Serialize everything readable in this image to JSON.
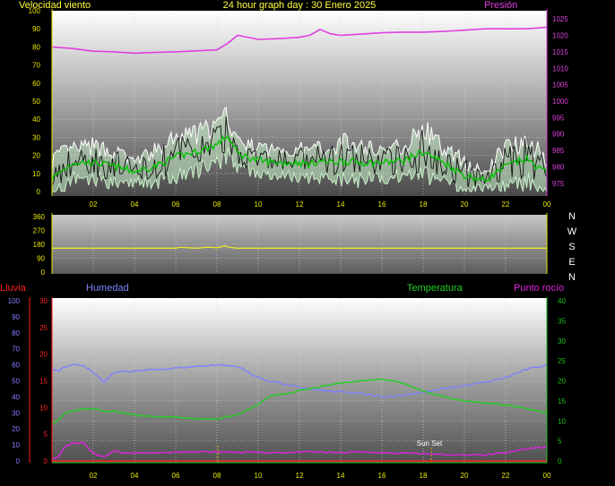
{
  "header": {
    "title": "24 hour graph day : 30 Enero 2025",
    "left_label": "Velocidad viento",
    "right_label": "Presión"
  },
  "colors": {
    "background": "#000000",
    "wind_speed": "#ffffff",
    "wind_avg": "#00c000",
    "wind_gust_fill": "#c8f0c8",
    "pressure": "#e040e0",
    "direction": "#e8e830",
    "humidity": "#8080ff",
    "temperature": "#20d020",
    "dewpoint": "#e020e0",
    "rain": "#ff2020",
    "axis_yellow": "#e8e800",
    "axis_red": "#ff2020",
    "axis_green": "#20c020",
    "marker": "#e0a000"
  },
  "time_ticks": [
    "02",
    "04",
    "06",
    "08",
    "10",
    "12",
    "14",
    "16",
    "18",
    "20",
    "22",
    "00"
  ],
  "chart_data": [
    {
      "type": "line",
      "name": "wind-pressure",
      "title": "24 hour graph day : 30 Enero 2025",
      "left_axis": {
        "label": "Velocidad viento",
        "ticks": [
          "0",
          "10",
          "20",
          "30",
          "40",
          "50",
          "60",
          "70",
          "80",
          "90",
          "100"
        ],
        "range": [
          0,
          100
        ]
      },
      "right_axis": {
        "label": "Presión",
        "ticks": [
          "975",
          "980",
          "985",
          "990",
          "995",
          "1000",
          "1005",
          "1010",
          "1015",
          "1020",
          "1025"
        ],
        "range": [
          972.5,
          1027.5
        ]
      },
      "x_hours": [
        0,
        1,
        2,
        3,
        4,
        5,
        6,
        7,
        8,
        8.5,
        9,
        10,
        11,
        12,
        12.5,
        13,
        13.5,
        14,
        15,
        16,
        17,
        18,
        19,
        20,
        21,
        22,
        23,
        24
      ],
      "series": [
        {
          "key": "pressure",
          "axis": "right",
          "values": [
            1016.5,
            1016,
            1015.2,
            1015,
            1014.6,
            1014.8,
            1015,
            1015.3,
            1015.6,
            1017.5,
            1020,
            1018.8,
            1019,
            1019.4,
            1020,
            1021.8,
            1020.5,
            1020,
            1020.4,
            1020.8,
            1021,
            1021,
            1021.2,
            1021.6,
            1022,
            1022,
            1022,
            1022.5
          ]
        },
        {
          "key": "wind_avg",
          "axis": "left",
          "values": [
            7,
            16,
            16,
            14,
            11,
            14,
            19,
            22,
            26,
            31,
            21,
            17,
            16,
            16,
            15,
            17,
            16,
            17,
            16,
            16,
            17,
            22,
            16,
            9,
            6,
            14,
            18,
            10
          ]
        },
        {
          "key": "wind_speed_peak",
          "axis": "left",
          "values": [
            24,
            28,
            30,
            27,
            20,
            27,
            35,
            38,
            42,
            48,
            32,
            28,
            27,
            28,
            26,
            30,
            28,
            33,
            30,
            28,
            30,
            42,
            28,
            22,
            12,
            32,
            36,
            22
          ]
        }
      ]
    },
    {
      "type": "line",
      "name": "wind-direction",
      "axis": {
        "ticks": [
          "0",
          "90",
          "180",
          "270",
          "360"
        ],
        "range": [
          0,
          360
        ]
      },
      "compass": [
        "N",
        "W",
        "S",
        "E",
        "N"
      ],
      "x_hours": [
        0,
        6,
        6.2,
        7,
        7.6,
        8,
        8.4,
        8.6,
        9,
        24
      ],
      "series": [
        {
          "key": "direction",
          "values": [
            155,
            155,
            160,
            155,
            162,
            158,
            170,
            160,
            155,
            155
          ]
        }
      ]
    },
    {
      "type": "line",
      "name": "humidity-temperature",
      "labels": {
        "rain": "Lluvia",
        "humidity": "Humedad",
        "temperature": "Temperatura",
        "dewpoint": "Punto rocío"
      },
      "humidity_axis": {
        "ticks": [
          "0",
          "10",
          "20",
          "30",
          "40",
          "50",
          "60",
          "70",
          "80",
          "90",
          "100"
        ],
        "range": [
          0,
          100
        ]
      },
      "rain_axis": {
        "ticks": [
          "0",
          "5",
          "10",
          "15",
          "20",
          "25",
          "30"
        ],
        "range": [
          0,
          30
        ]
      },
      "temp_axis": {
        "ticks": [
          "0",
          "5",
          "10",
          "15",
          "20",
          "25",
          "30",
          "35",
          "40"
        ],
        "range": [
          0,
          40
        ]
      },
      "annotation": {
        "text": "Sun Set",
        "hour": 18.4
      },
      "marker_hour": 8.05,
      "x_hours": [
        0,
        0.3,
        0.6,
        1,
        1.5,
        2,
        2.5,
        3,
        3.5,
        4,
        5,
        6,
        7,
        8,
        9,
        10,
        10.5,
        11,
        11.5,
        12,
        13,
        14,
        15,
        16,
        17,
        18,
        19,
        20,
        21,
        22,
        23,
        24
      ],
      "series": [
        {
          "key": "humidity",
          "axis": "humidity",
          "values": [
            58,
            56,
            59,
            60,
            60,
            55,
            49,
            55,
            56,
            56,
            57,
            58,
            59,
            60,
            59,
            52,
            50,
            49,
            47,
            46,
            44,
            43,
            42,
            40,
            41,
            43,
            45,
            47,
            49,
            52,
            57,
            60
          ]
        },
        {
          "key": "temperature",
          "axis": "temp",
          "values": [
            9.5,
            10,
            12,
            12.5,
            13,
            13,
            12.5,
            12.3,
            12,
            11.5,
            11,
            11,
            10.5,
            10.5,
            11.5,
            14,
            16,
            16.5,
            17,
            17.5,
            18.5,
            19.5,
            20,
            20.5,
            19.5,
            17.5,
            16,
            15,
            14.5,
            14,
            13,
            12
          ]
        },
        {
          "key": "dewpoint",
          "axis": "temp",
          "values": [
            0.5,
            1,
            3.5,
            4.5,
            4.5,
            2,
            1,
            2.5,
            2,
            2,
            2,
            2.1,
            2.2,
            2.3,
            2.2,
            2.2,
            2,
            2.1,
            2,
            2.3,
            2.2,
            2,
            2.3,
            2,
            1.9,
            1.8,
            1.6,
            1.4,
            1.5,
            2,
            3,
            3.5
          ]
        },
        {
          "key": "rain",
          "axis": "rain",
          "values": [
            0,
            0,
            0,
            0,
            0,
            0,
            0,
            0,
            0,
            0,
            0,
            0,
            0,
            0,
            0,
            0,
            0,
            0,
            0,
            0,
            0,
            0,
            0,
            0,
            0,
            0,
            0,
            0,
            0,
            0,
            0,
            0
          ]
        }
      ]
    }
  ]
}
